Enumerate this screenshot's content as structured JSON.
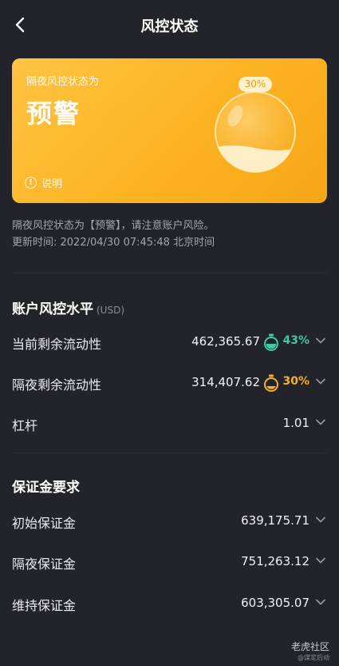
{
  "header": {
    "title": "风控状态"
  },
  "card": {
    "label": "隔夜风控状态为",
    "status": "预警",
    "percent": "30%",
    "fill_fraction": 0.3,
    "info_label": "说明"
  },
  "notice": {
    "description": "隔夜风控状态为【预警】，请注意账户风险。",
    "updated": "更新时间: 2022/04/30 07:45:48 北京时间"
  },
  "risk_section": {
    "title": "账户风控水平",
    "unit": "(USD)",
    "rows": [
      {
        "label": "当前剩余流动性",
        "value": "462,365.67",
        "percent": "43%",
        "percent_color": "#3ec9a7",
        "icon": "gauge-icon-green"
      },
      {
        "label": "隔夜剩余流动性",
        "value": "314,407.62",
        "percent": "30%",
        "percent_color": "#f5b31d",
        "icon": "gauge-icon-yellow"
      },
      {
        "label": "杠杆",
        "value": "1.01"
      }
    ]
  },
  "margin_section": {
    "title": "保证金要求",
    "rows": [
      {
        "label": "初始保证金",
        "value": "639,175.71"
      },
      {
        "label": "隔夜保证金",
        "value": "751,263.12"
      },
      {
        "label": "维持保证金",
        "value": "603,305.07"
      }
    ]
  },
  "watermark": {
    "line1": "老虎社区",
    "line2": "@谋定后动"
  },
  "colors": {
    "background": "#23232b",
    "card_yellow": "#fcb322",
    "green": "#3ec9a7",
    "yellow": "#f5b31d"
  }
}
